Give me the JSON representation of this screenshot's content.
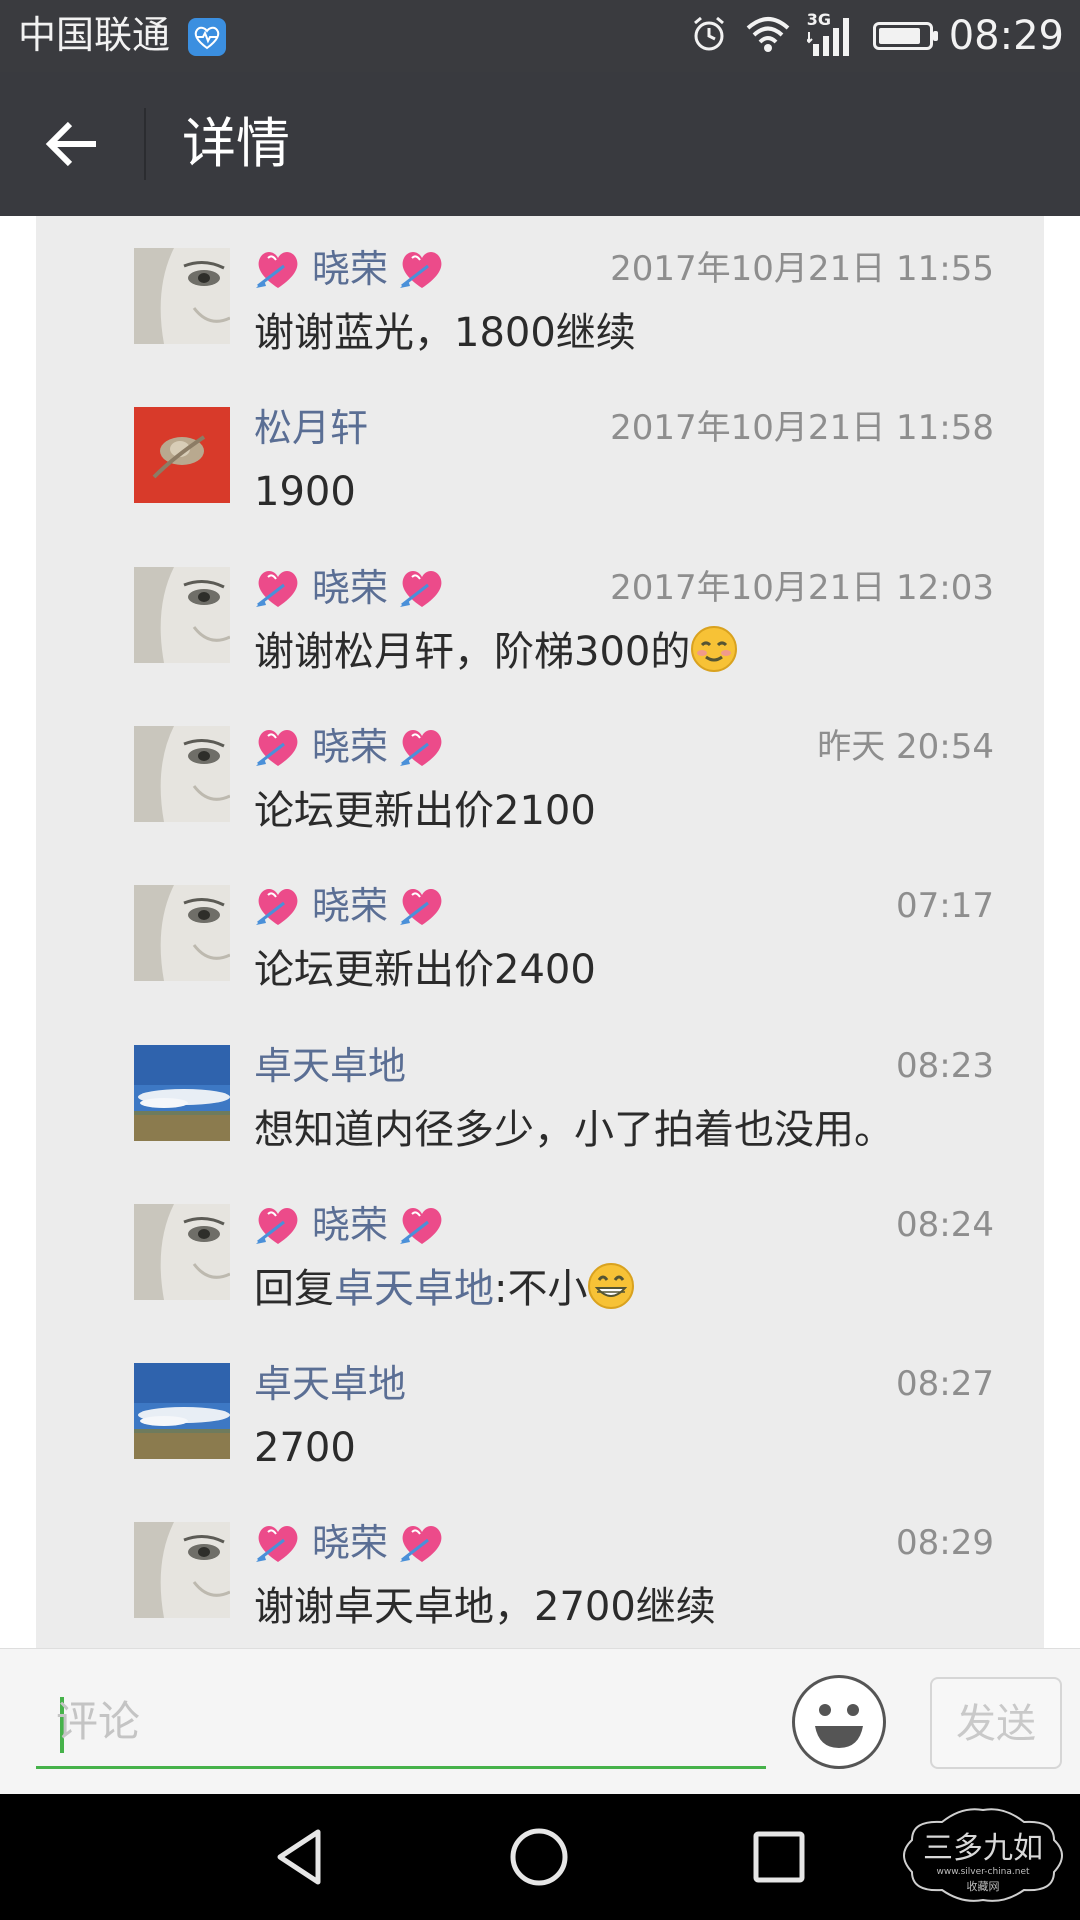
{
  "status_bar": {
    "carrier": "中国联通",
    "network": "3G",
    "time": "08:29",
    "battery_level": 0.85
  },
  "header": {
    "title": "详情"
  },
  "comments": [
    {
      "name": "晓荣",
      "hearts": true,
      "time": "2017年10月21日 11:55",
      "avatar": "face",
      "text": "谢谢蓝光，1800继续"
    },
    {
      "name": "松月轩",
      "hearts": false,
      "time": "2017年10月21日 11:58",
      "avatar": "red",
      "text": "1900"
    },
    {
      "name": "晓荣",
      "hearts": true,
      "time": "2017年10月21日 12:03",
      "avatar": "face",
      "text": "谢谢松月轩，阶梯300的",
      "emoji": "blush-emoji"
    },
    {
      "name": "晓荣",
      "hearts": true,
      "time": "昨天 20:54",
      "avatar": "face",
      "text": "论坛更新出价2100"
    },
    {
      "name": "晓荣",
      "hearts": true,
      "time": "07:17",
      "avatar": "face",
      "text": "论坛更新出价2400"
    },
    {
      "name": "卓天卓地",
      "hearts": false,
      "time": "08:23",
      "avatar": "sky",
      "text": "想知道内径多少，小了拍着也没用。"
    },
    {
      "name": "晓荣",
      "hearts": true,
      "time": "08:24",
      "avatar": "face",
      "reply_prefix": "回复",
      "reply_to": "卓天卓地",
      "text": ":不小",
      "emoji": "grin-emoji"
    },
    {
      "name": "卓天卓地",
      "hearts": false,
      "time": "08:27",
      "avatar": "sky",
      "text": "2700"
    },
    {
      "name": "晓荣",
      "hearts": true,
      "time": "08:29",
      "avatar": "face",
      "text": "谢谢卓天卓地，2700继续"
    }
  ],
  "comment_bar": {
    "placeholder": "评论",
    "send_label": "发送"
  },
  "watermark": {
    "text": "三多九如",
    "url": "www.silver-china.net",
    "sub": "收藏网"
  },
  "colors": {
    "header_bg": "#393a3f",
    "name_link": "#5a6e94",
    "accent_green": "#46b24a"
  }
}
